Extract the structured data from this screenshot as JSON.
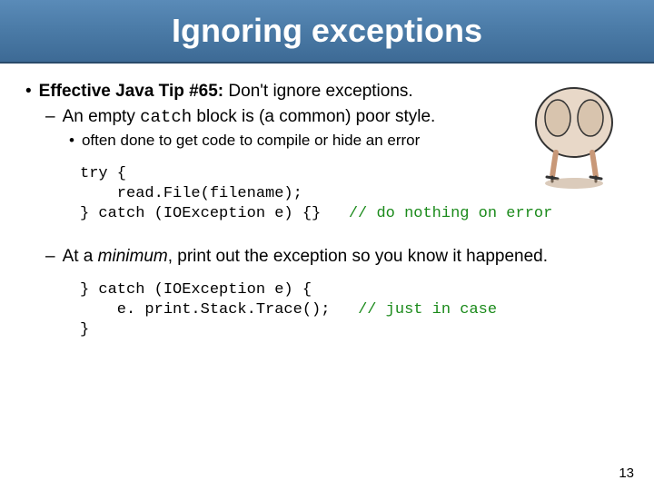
{
  "title": "Ignoring exceptions",
  "bullet1_label": "Effective Java Tip #65:",
  "bullet1_text": " Don't ignore exceptions.",
  "dash1_a": "An empty ",
  "dash1_code": "catch",
  "dash1_b": " block is (a common) poor style.",
  "sub1": "often done to get code to compile or hide an error",
  "code1_l1": "try {",
  "code1_l2": "    read.File(filename);",
  "code1_l3a": "} catch (IOException e) {}   ",
  "code1_l3b": "// do nothing on error",
  "dash2_a": "At a ",
  "dash2_i": "minimum",
  "dash2_b": ", print out the exception so you know it happened.",
  "code2_l1": "} catch (IOException e) {",
  "code2_l2a": "    e. print.Stack.Trace();   ",
  "code2_l2b": "// just in case",
  "code2_l3": "}",
  "page_number": "13"
}
